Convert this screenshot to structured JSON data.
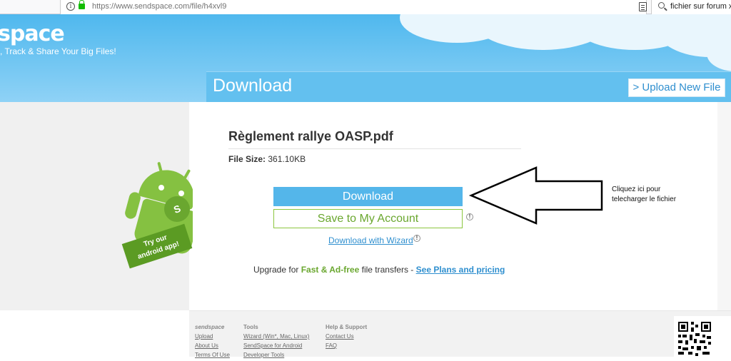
{
  "browser": {
    "url": "https://www.sendspace.com/file/h4xvl9",
    "search_text": "fichier sur forum x"
  },
  "header": {
    "logo": "space",
    "tagline": ", Track & Share Your Big Files!",
    "section_title": "Download",
    "upload_button": "> Upload New File"
  },
  "file": {
    "name": "Règlement rallye OASP.pdf",
    "size_label": "File Size:",
    "size_value": "361.10KB"
  },
  "actions": {
    "download_label": "Download",
    "save_label": "Save to My Account",
    "wizard_label": "Download with Wizard"
  },
  "upgrade": {
    "prefix": "Upgrade for ",
    "highlight": "Fast & Ad-free",
    "middle": " file transfers - ",
    "link": "See Plans and pricing"
  },
  "promo": {
    "android_line1": "Try our",
    "android_line2": "android app!"
  },
  "annotation": {
    "line1": "Cliquez ici pour",
    "line2": "telecharger le fichier"
  },
  "footer": {
    "columns": [
      {
        "heading": "sendspace",
        "links": [
          "Upload",
          "About Us",
          "Terms Of Use"
        ]
      },
      {
        "heading": "Tools",
        "links": [
          "Wizard (Win*, Mac, Linux)",
          "SendSpace for Android",
          "Developer Tools"
        ]
      },
      {
        "heading": "Help & Support",
        "links": [
          "Contact Us",
          "FAQ"
        ]
      }
    ]
  },
  "colors": {
    "accent_blue": "#54b6ea",
    "green": "#6aa72f",
    "link_blue": "#2f8fcf"
  }
}
